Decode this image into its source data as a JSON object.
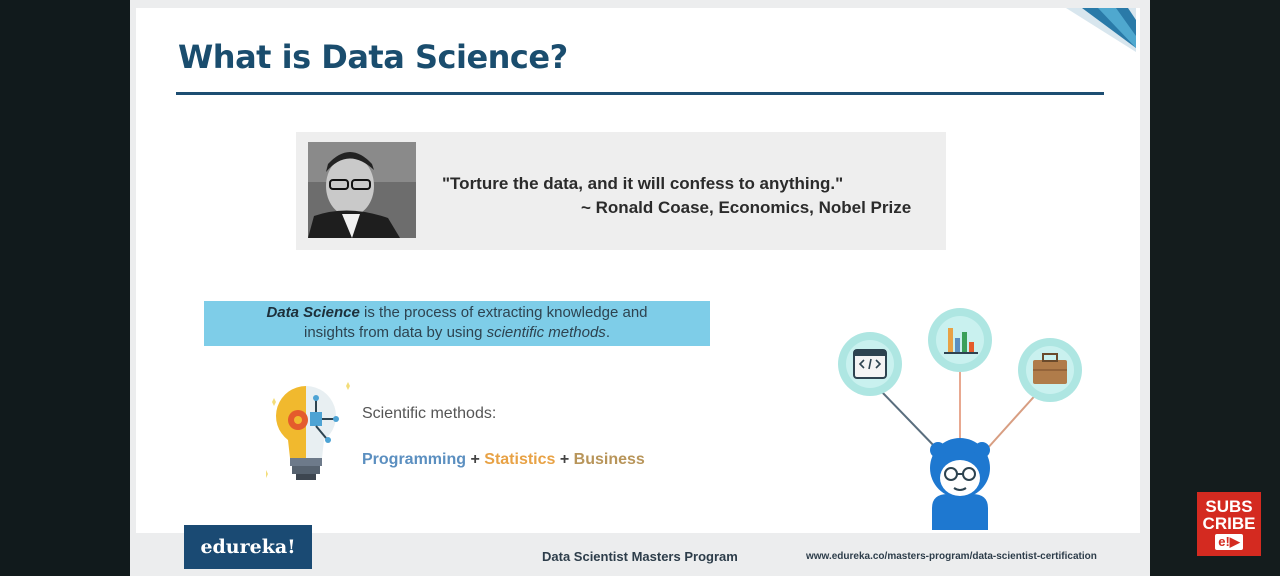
{
  "slide": {
    "title": "What is Data Science?",
    "quote": {
      "text": "\"Torture the data, and it will confess to anything.\"",
      "attribution": "~ Ronald Coase, Economics, Nobel Prize"
    },
    "definition": {
      "term": "Data Science",
      "part1": " is the process of extracting knowledge and",
      "part2": "insights from data by using ",
      "emphasis": "scientific methods",
      "end": "."
    },
    "scientific_label": "Scientific methods:",
    "methods": {
      "programming": "Programming",
      "plus": "+",
      "statistics": "Statistics",
      "business": "Business"
    },
    "footer": {
      "logo": "edureka!",
      "program": "Data Scientist Masters Program",
      "url": "www.edureka.co/masters-program/data-scientist-certification"
    }
  },
  "overlay": {
    "subscribe_line1": "SUBS",
    "subscribe_line2": "CRIBE",
    "subscribe_icon": "e!▶"
  },
  "colors": {
    "title": "#1a4d6e",
    "definition_bg": "#7ecde8",
    "programming": "#5b8fc0",
    "statistics": "#e8a245",
    "business": "#b8955a",
    "subscribe_bg": "#d42a20"
  },
  "icons": [
    "lightbulb-icon",
    "code-icon",
    "bar-chart-icon",
    "briefcase-icon",
    "data-scientist-icon",
    "subscribe-icon"
  ]
}
